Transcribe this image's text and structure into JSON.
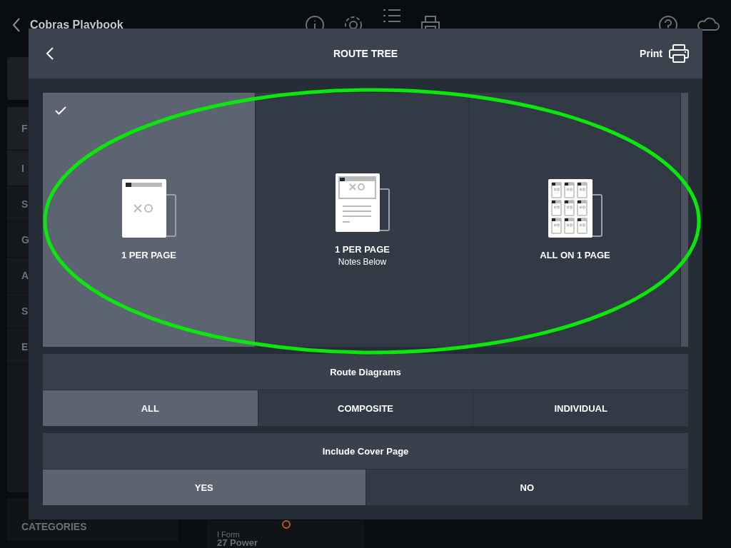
{
  "app": {
    "title": "Cobras Playbook",
    "sidebar_items": [
      "F",
      "I",
      "S",
      "G",
      "A",
      "S",
      "E"
    ],
    "categories": "CATEGORIES",
    "card": {
      "subtitle": "I Form",
      "title": "27 Power"
    }
  },
  "dialog": {
    "title": "ROUTE TREE",
    "print": "Print",
    "layouts": [
      {
        "label": "1 PER PAGE",
        "kind": "single",
        "selected": true
      },
      {
        "label": "1 PER PAGE",
        "sublabel": "Notes Below",
        "kind": "notes",
        "selected": false
      },
      {
        "label": "ALL ON 1 PAGE",
        "kind": "grid",
        "selected": false
      }
    ],
    "route_diagrams": {
      "title": "Route Diagrams",
      "options": [
        {
          "label": "ALL",
          "selected": true
        },
        {
          "label": "COMPOSITE",
          "selected": false
        },
        {
          "label": "INDIVIDUAL",
          "selected": false
        }
      ]
    },
    "cover_page": {
      "title": "Include Cover Page",
      "options": [
        {
          "label": "YES",
          "selected": true
        },
        {
          "label": "NO",
          "selected": false
        }
      ]
    }
  }
}
